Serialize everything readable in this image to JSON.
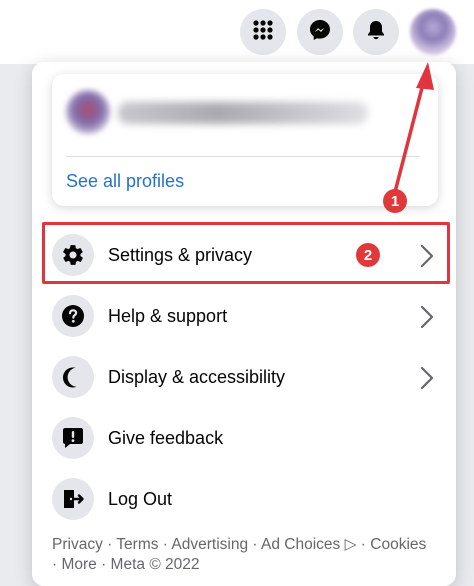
{
  "topbar": {
    "icons": [
      "menu-grid-icon",
      "messenger-icon",
      "notifications-bell-icon",
      "profile-avatar"
    ]
  },
  "profile_card": {
    "see_all_label": "See all profiles"
  },
  "menu": {
    "items": [
      {
        "label": "Settings & privacy",
        "icon": "gear-icon",
        "has_chevron": true
      },
      {
        "label": "Help & support",
        "icon": "question-icon",
        "has_chevron": true
      },
      {
        "label": "Display & accessibility",
        "icon": "moon-icon",
        "has_chevron": true
      },
      {
        "label": "Give feedback",
        "icon": "feedback-icon",
        "has_chevron": false
      },
      {
        "label": "Log Out",
        "icon": "logout-icon",
        "has_chevron": false
      }
    ]
  },
  "annotations": {
    "step1": "1",
    "step2": "2",
    "color": "#e0353e"
  },
  "footer": {
    "line1": "Privacy · Terms · Advertising · Ad Choices ▷ · Cookies",
    "line2": "· More · Meta © 2022"
  }
}
